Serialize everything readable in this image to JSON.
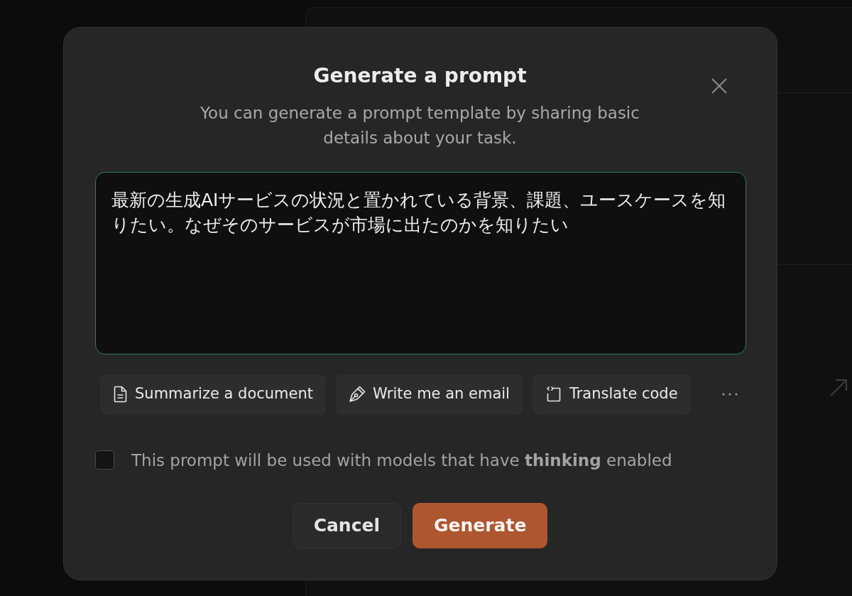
{
  "dialog": {
    "title": "Generate a prompt",
    "subtitle": "You can generate a prompt template by sharing basic details about your task."
  },
  "task_input": {
    "value": "最新の生成AIサービスの状況と置かれている背景、課題、ユースケースを知りたい。なぜそのサービスが市場に出たのかを知りたい",
    "focused": true
  },
  "suggestions": [
    {
      "kind": "document",
      "label": "Summarize a document"
    },
    {
      "kind": "pen",
      "label": "Write me an email"
    },
    {
      "kind": "code",
      "label": "Translate code"
    }
  ],
  "thinking_option": {
    "label": "This prompt will be used with models that have **thinking** enabled",
    "checked": false
  },
  "buttons": [
    {
      "kind": "cancel",
      "label": "Cancel"
    },
    {
      "kind": "submit",
      "label": "Generate"
    }
  ]
}
